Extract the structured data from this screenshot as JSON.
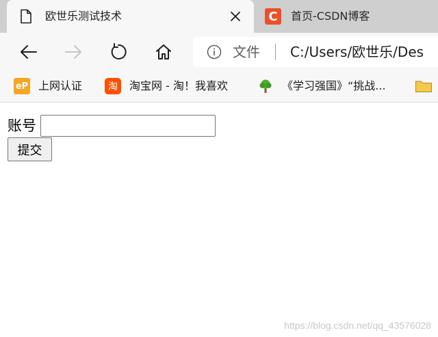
{
  "tabs": [
    {
      "title": "欧世乐测试技术",
      "active": true,
      "icon": "page-icon"
    },
    {
      "title": "首页-CSDN博客",
      "active": false,
      "icon": "csdn-logo-icon",
      "icon_text": "C"
    }
  ],
  "addressbar": {
    "scheme_label": "文件",
    "url": "C:/Users/欧世乐/Des"
  },
  "favorites": [
    {
      "label": "上网认证",
      "icon": "ep-logo-icon",
      "icon_text": "eP"
    },
    {
      "label": "淘宝网 - 淘！我喜欢",
      "icon": "taobao-logo-icon",
      "icon_text": "淘"
    },
    {
      "label": "《学习强国》“挑战...",
      "icon": "tree-icon"
    },
    {
      "label": "",
      "icon": "folder-icon"
    }
  ],
  "page": {
    "account_label": "账号",
    "account_value": "",
    "submit_label": "提交"
  },
  "watermark": "https://blog.csdn.net/qq_43576028",
  "colors": {
    "tabstrip": "#cfcfcf",
    "toolbar": "#f7f7f7",
    "csdn": "#e9502b",
    "taobao": "#ff5000",
    "ep": "#f5a623",
    "folder": "#f6c94a"
  }
}
